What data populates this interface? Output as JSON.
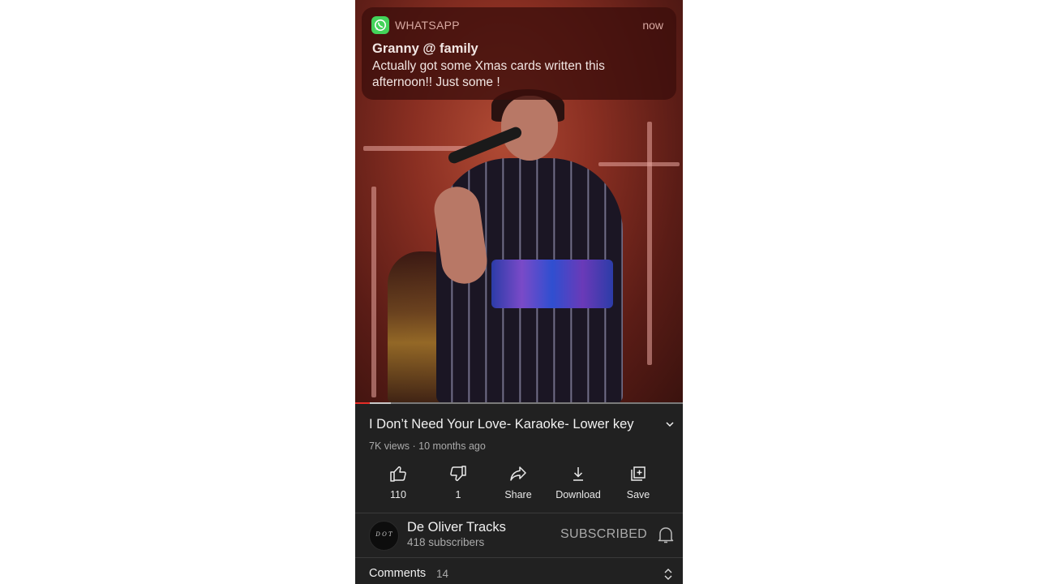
{
  "notification": {
    "app_name": "WHATSAPP",
    "time": "now",
    "title": "Granny @ family",
    "body": "Actually got some Xmas cards written this afternoon!! Just some !",
    "icon": "whatsapp-icon"
  },
  "player": {
    "progress_fraction": 0.045,
    "buffered_fraction": 0.11
  },
  "video": {
    "title": "I Don’t Need Your Love- Karaoke- Lower key",
    "meta": "7K views · 10 months ago"
  },
  "actions": [
    {
      "label": "110",
      "icon": "thumbs-up-icon"
    },
    {
      "label": "1",
      "icon": "thumbs-down-icon"
    },
    {
      "label": "Share",
      "icon": "share-icon"
    },
    {
      "label": "Download",
      "icon": "download-icon"
    },
    {
      "label": "Save",
      "icon": "save-playlist-icon"
    }
  ],
  "channel": {
    "name": "De Oliver Tracks",
    "subscribers": "418 subscribers",
    "subscribe_state": "SUBSCRIBED",
    "avatar_text": "D O T"
  },
  "comments": {
    "label": "Comments",
    "count": "14"
  },
  "colors": {
    "background": "#212121",
    "progress": "#e52d27",
    "whatsapp": "#43d35a"
  }
}
